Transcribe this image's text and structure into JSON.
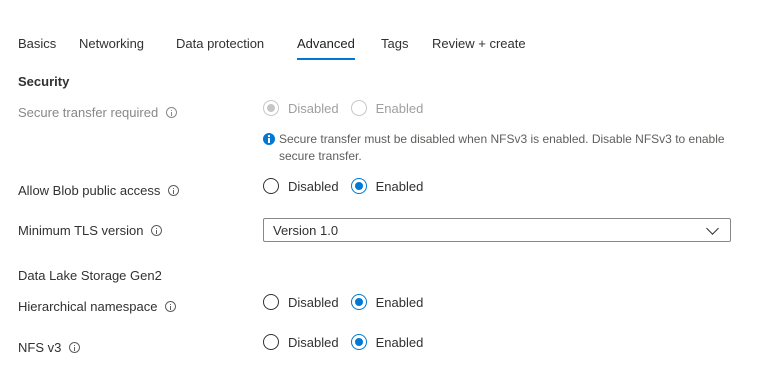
{
  "tabs": [
    {
      "label": "Basics"
    },
    {
      "label": "Networking"
    },
    {
      "label": "Data protection"
    },
    {
      "label": "Advanced",
      "active": true
    },
    {
      "label": "Tags"
    },
    {
      "label": "Review + create"
    }
  ],
  "security": {
    "title": "Security",
    "secure_transfer": {
      "label": "Secure transfer required",
      "options": [
        "Disabled",
        "Enabled"
      ],
      "selected": "Disabled",
      "disabled": true
    },
    "info_message": "Secure transfer must be disabled when NFSv3 is enabled. Disable NFSv3 to enable secure transfer.",
    "blob_public_access": {
      "label": "Allow Blob public access",
      "options": [
        "Disabled",
        "Enabled"
      ],
      "selected": "Enabled"
    },
    "tls_version": {
      "label": "Minimum TLS version",
      "value": "Version 1.0"
    }
  },
  "data_lake": {
    "title": "Data Lake Storage Gen2",
    "hierarchical_namespace": {
      "label": "Hierarchical namespace",
      "options": [
        "Disabled",
        "Enabled"
      ],
      "selected": "Enabled"
    },
    "nfs_v3": {
      "label": "NFS v3",
      "options": [
        "Disabled",
        "Enabled"
      ],
      "selected": "Enabled"
    }
  },
  "colors": {
    "accent": "#0078d4",
    "text": "#323130",
    "disabled_text": "#8a8886"
  },
  "icons": {
    "info": "info-icon",
    "info_filled": "info-filled-icon",
    "dropdown": "chevron-down-icon"
  }
}
